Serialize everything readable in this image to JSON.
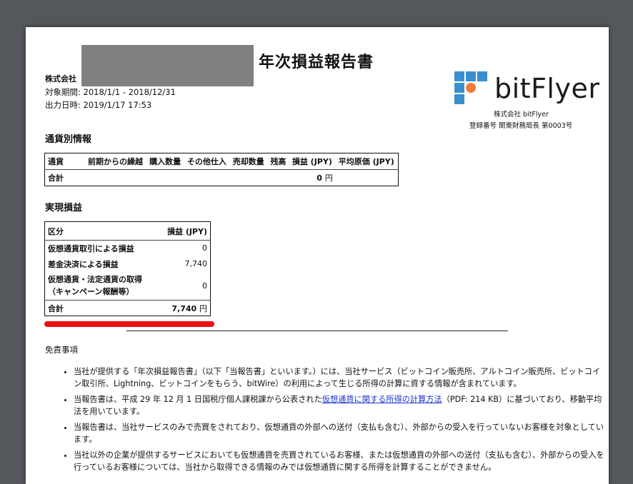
{
  "document": {
    "title": "年次損益報告書",
    "company_line": "株式会社",
    "period": "対象期間: 2018/1/1 - 2018/12/31",
    "output_date": "出力日時: 2019/1/17 17:53"
  },
  "issuer": {
    "logo_text": "bitFlyer",
    "name": "株式会社 bitFlyer",
    "registration": "登録番号 関東財務局長 第0003号"
  },
  "currency_section": {
    "heading": "通貨別情報",
    "headers": [
      "通貨",
      "前期からの繰越",
      "購入数量",
      "その他仕入",
      "売却数量",
      "残高",
      "損益 (JPY)",
      "平均原価 (JPY)"
    ],
    "total_label": "合計",
    "total_value": "0",
    "total_unit": "円"
  },
  "realized_section": {
    "heading": "実現損益",
    "col_category": "区分",
    "col_profit": "損益 (JPY)",
    "rows": [
      {
        "label": "仮想通貨取引による損益",
        "value": "0"
      },
      {
        "label": "差金決済による損益",
        "value": "7,740"
      },
      {
        "label_line1": "仮想通貨・法定通貨の取得",
        "label_line2": "（キャンペーン報酬等）",
        "value": "0"
      }
    ],
    "total_label": "合計",
    "total_value": "7,740",
    "total_unit": "円"
  },
  "disclaimer": {
    "heading": "免責事項",
    "items": [
      {
        "text": "当社が提供する「年次損益報告書」（以下「当報告書」といいます。）には、当社サービス（ビットコイン販売所、アルトコイン販売所、ビットコイン取引所、Lightning、ビットコインをもらう、bitWire）の利用によって生じる所得の計算に資する情報が含まれています。"
      },
      {
        "pre": "当報告書は、平成 29 年 12 月 1 日国税庁個人課税課から公表された",
        "link": "仮想通貨に関する所得の計算方法",
        "post": "（PDF: 214 KB）に基づいており、移動平均法を用いています。"
      },
      {
        "text": "当報告書は、当社サービスのみで売買をされており、仮想通貨の外部への送付（支払も含む）、外部からの受入を行っていないお客様を対象としています。"
      },
      {
        "text": "当社以外の企業が提供するサービスにおいても仮想通貨を売買されているお客様、または仮想通貨の外部への送付（支払も含む）、外部からの受入を行っているお客様については、当社から取得できる情報のみでは仮想通貨に関する所得を計算することができません。"
      }
    ]
  },
  "colors": {
    "logo_blue": "#3a8fd0",
    "logo_orange": "#f07c3a",
    "highlight_red": "#ee1111",
    "link_blue": "#1a33cc"
  }
}
